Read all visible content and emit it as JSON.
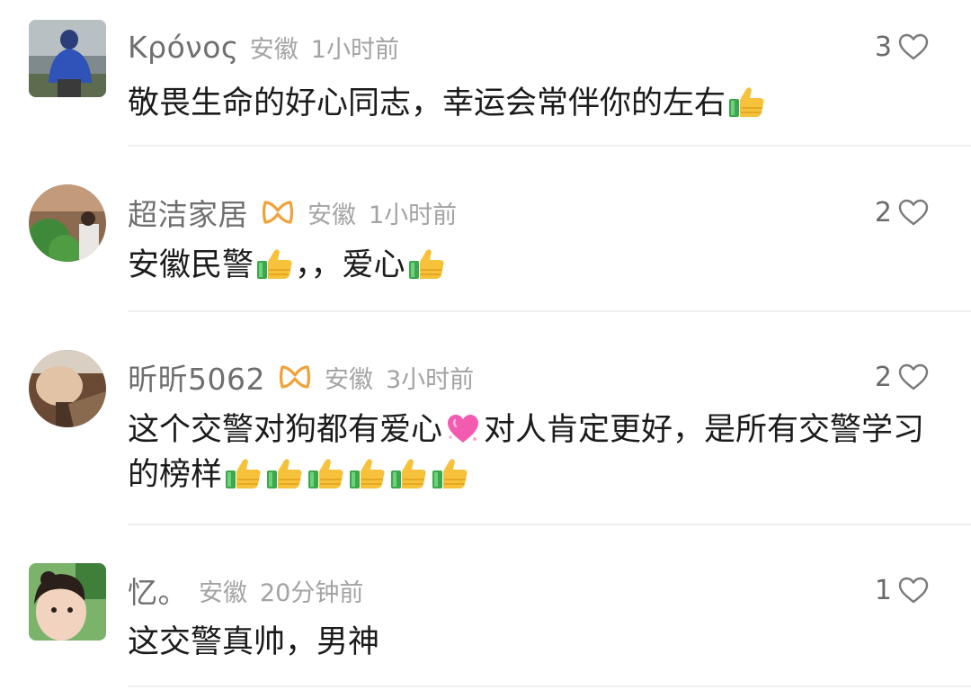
{
  "comments": [
    {
      "username": "Κρόνος",
      "location": "安徽",
      "time": "1小时前",
      "likes": "3",
      "segments": [
        "敬畏生命的好心同志，幸运会常伴你的左右"
      ],
      "vip": false
    },
    {
      "username": "超洁家居",
      "location": "安徽",
      "time": "1小时前",
      "likes": "2",
      "segments": [
        "安徽民警",
        "，，爱心"
      ],
      "vip": true
    },
    {
      "username": "昕昕5062",
      "location": "安徽",
      "time": "3小时前",
      "likes": "2",
      "segments": [
        "这个交警对狗都有爱心",
        "对人肯定更好，是所有交警学习的榜样"
      ],
      "vip": true
    },
    {
      "username": "忆。",
      "location": "安徽",
      "time": "20分钟前",
      "likes": "1",
      "segments": [
        "这交警真帅，男神"
      ],
      "vip": false
    }
  ],
  "icons": {
    "like": "heart-outline-icon",
    "thumbs_up": "thumbs-up-emoji",
    "pink_heart": "sparkling-heart-emoji",
    "vip_badge": "vip-badge-icon"
  },
  "colors": {
    "username": "#6f6f6f",
    "meta": "#a3a3a3",
    "text": "#1b1b1b",
    "badge": "#f0a23a"
  }
}
